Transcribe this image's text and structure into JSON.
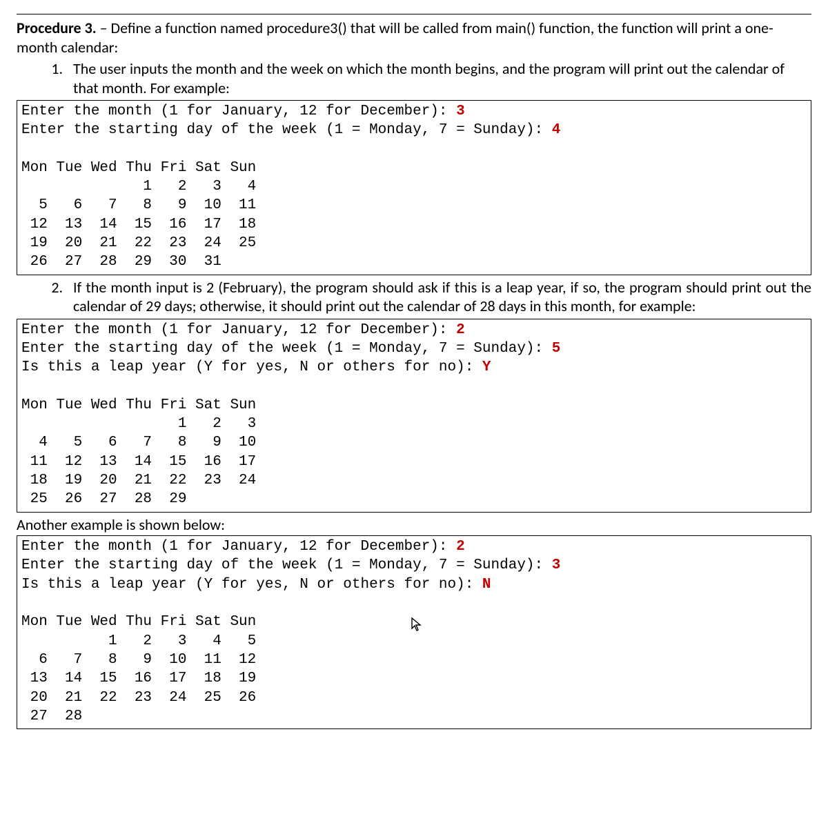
{
  "header": {
    "procedure_label": "Procedure 3.",
    "intro": " – Define a function named procedure3() that will be called from main() function, the function will print a one-month calendar:"
  },
  "item1": {
    "text": "The user inputs the month and the week on which the month begins, and the program will print out the calendar of that month. For example:"
  },
  "box1": {
    "line1": "Enter the month (1 for January, 12 for December): ",
    "input1": "3",
    "line2": "Enter the starting day of the week (1 = Monday, 7 = Sunday): ",
    "input2": "4",
    "calendar": "\nMon Tue Wed Thu Fri Sat Sun\n              1   2   3   4\n  5   6   7   8   9  10  11\n 12  13  14  15  16  17  18\n 19  20  21  22  23  24  25\n 26  27  28  29  30  31"
  },
  "item2": {
    "text": "If the month input is 2 (February), the program should ask if this is a leap year, if so, the program should print out the calendar of 29 days; otherwise, it should print out the calendar of 28 days in this month, for example:"
  },
  "box2": {
    "line1": "Enter the month (1 for January, 12 for December): ",
    "input1": "2",
    "line2": "Enter the starting day of the week (1 = Monday, 7 = Sunday): ",
    "input2": "5",
    "line3": "Is this a leap year (Y for yes, N or others for no): ",
    "input3": "Y",
    "calendar": "\nMon Tue Wed Thu Fri Sat Sun\n                  1   2   3\n  4   5   6   7   8   9  10\n 11  12  13  14  15  16  17\n 18  19  20  21  22  23  24\n 25  26  27  28  29"
  },
  "between_label": "Another example is shown below:",
  "box3": {
    "line1": "Enter the month (1 for January, 12 for December): ",
    "input1": "2",
    "line2": "Enter the starting day of the week (1 = Monday, 7 = Sunday): ",
    "input2": "3",
    "line3": "Is this a leap year (Y for yes, N or others for no): ",
    "input3": "N",
    "calendar": "\nMon Tue Wed Thu Fri Sat Sun\n          1   2   3   4   5\n  6   7   8   9  10  11  12\n 13  14  15  16  17  18  19\n 20  21  22  23  24  25  26\n 27  28"
  }
}
